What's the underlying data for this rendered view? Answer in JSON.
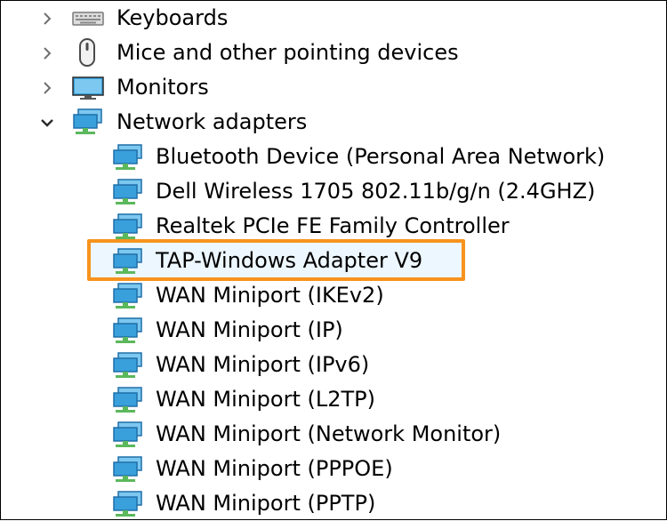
{
  "categories": [
    {
      "label": "Keyboards",
      "icon": "keyboard-icon",
      "expanded": false
    },
    {
      "label": "Mice and other pointing devices",
      "icon": "mouse-icon",
      "expanded": false
    },
    {
      "label": "Monitors",
      "icon": "monitor-icon",
      "expanded": false
    },
    {
      "label": "Network adapters",
      "icon": "network-adapter-icon",
      "expanded": true
    }
  ],
  "network_adapters": [
    {
      "label": "Bluetooth Device (Personal Area Network)"
    },
    {
      "label": "Dell Wireless 1705 802.11b/g/n (2.4GHZ)"
    },
    {
      "label": "Realtek PCIe FE Family Controller"
    },
    {
      "label": "TAP-Windows Adapter V9",
      "highlighted": true
    },
    {
      "label": "WAN Miniport (IKEv2)"
    },
    {
      "label": "WAN Miniport (IP)"
    },
    {
      "label": "WAN Miniport (IPv6)"
    },
    {
      "label": "WAN Miniport (L2TP)"
    },
    {
      "label": "WAN Miniport (Network Monitor)"
    },
    {
      "label": "WAN Miniport (PPPOE)"
    },
    {
      "label": "WAN Miniport (PPTP)"
    }
  ],
  "colors": {
    "highlight_border": "#f7931e",
    "adapter_icon": "#3aa0dc",
    "connector": "#5cb85c"
  }
}
